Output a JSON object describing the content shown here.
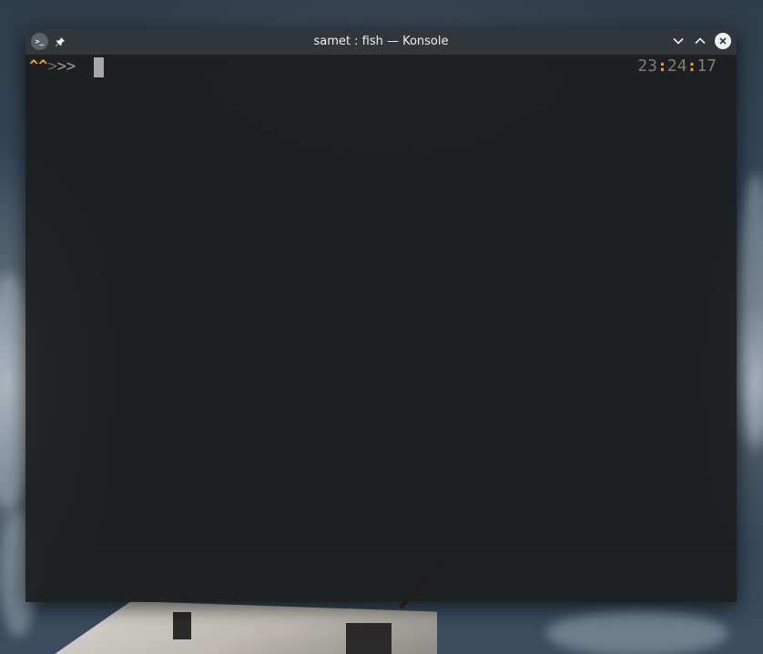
{
  "window": {
    "title": "samet : fish — Konsole",
    "app_icon": "konsole-terminal-icon",
    "app_icon_glyph": ">_",
    "pin_icon": "pin-icon",
    "buttons": {
      "minimize_icon": "chevron-down-icon",
      "maximize_icon": "chevron-up-icon",
      "close_icon": "close-icon"
    }
  },
  "terminal": {
    "prompt": {
      "carets": "^^",
      "arrow1": ">",
      "arrow2": ">>"
    },
    "clock": {
      "hours": "23",
      "sep1": ":",
      "minutes": "24",
      "sep2": ":",
      "seconds": "17"
    }
  },
  "colors": {
    "titlebar": "#31363b",
    "terminal_bg": "#1c1d1e",
    "accent": "#f0a30a",
    "dim_text": "#7d7d7d"
  }
}
